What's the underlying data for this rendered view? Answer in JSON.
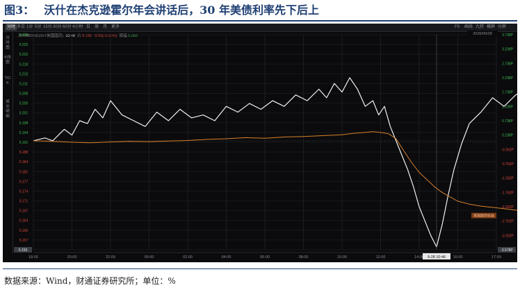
{
  "figure": {
    "number": "图3：",
    "title": "沃什在杰克逊霍尔年会讲话后，30 年美债利率先下后上",
    "source": "数据来源：Wind，财通证券研究所；单位：%"
  },
  "toolbar": {
    "items": [
      "分时",
      "多日",
      "1分",
      "5分",
      "15分",
      "30分",
      "60分",
      "4小时",
      "日",
      "周",
      "月",
      "更多"
    ],
    "right_items": [
      "F9",
      "画线",
      "九转",
      "横屏",
      "分屏"
    ],
    "date": "2026/09/28"
  },
  "info_bar": {
    "symbol": "30YRBOND(30Y",
    "market": "美国国债)",
    "time": "10:46",
    "price_label": "价",
    "price": "5.156",
    "change": "-5.53(-0.60%)",
    "volume_label": "振幅",
    "volume": "0.000"
  },
  "sidebar": [
    "分时图",
    "K线图",
    "TICK",
    "成交明细"
  ],
  "colors": {
    "price_line": "#f2f2f2",
    "pct_line": "#d9822b",
    "axis_left": "#e2483f",
    "axis_right": "#e2483f",
    "axis_up": "#3fbf55"
  },
  "chart_data": {
    "type": "line",
    "x_ticks": [
      "18:00",
      "20:00",
      "22:00",
      "00:00",
      "02:00",
      "04:00",
      "06:00",
      "08:00",
      "10:00",
      "12:00",
      "14:00",
      "16:00",
      "17:59"
    ],
    "y_left_ticks": [
      "5.228",
      "5.225",
      "5.222",
      "5.218",
      "5.215",
      "5.211",
      "5.208",
      "5.205",
      "5.201",
      "5.198",
      "5.194",
      "5.191",
      "5.188",
      "5.184",
      "5.181",
      "5.177",
      "5.174",
      "5.171",
      "5.167",
      "5.164",
      "5.160",
      "5.157",
      "5.153"
    ],
    "y_right_ticks": [
      "3.738P",
      "3.238P",
      "2.738P",
      "2.238P",
      "1.738P",
      "1.238P",
      "0.738P",
      "0.238P",
      "-0.262P",
      "-0.762P",
      "-1.262P",
      "-1.762P",
      "-2.262P",
      "-2.762P",
      "-3.262P",
      "-3.738P"
    ],
    "ylim_left": [
      5.153,
      5.228
    ],
    "ylim_right": [
      -3.738,
      3.738
    ],
    "crosshair_time": "9-28 10:46",
    "crosshair_price": "5.155",
    "crosshair_value": "-3.578P",
    "end_label": "美国国债收益",
    "series": [
      {
        "kind": "price",
        "axis": "left",
        "x": [
          0,
          0.3,
          0.5,
          0.8,
          1.0,
          1.2,
          1.4,
          1.6,
          1.8,
          2.0,
          2.3,
          2.6,
          2.9,
          3.2,
          3.5,
          3.8,
          4.1,
          4.4,
          4.7,
          5.0,
          5.3,
          5.6,
          5.9,
          6.2,
          6.5,
          6.8,
          7.1,
          7.4,
          7.6,
          7.8,
          8.0,
          8.2,
          8.4,
          8.6,
          8.8,
          8.95,
          9.1,
          9.25,
          9.4,
          9.55,
          9.7,
          9.85,
          10.0,
          10.15,
          10.3,
          10.45,
          10.6,
          10.75,
          10.9,
          11.1,
          11.3,
          11.6,
          11.9,
          12.2,
          12.5,
          12.8,
          13.1,
          13.4,
          13.7,
          14.0,
          14.3,
          14.6,
          14.9,
          15.2,
          15.5,
          15.8,
          16.0,
          16.2,
          16.4,
          16.6,
          16.8,
          17.0
        ],
        "y": [
          5.191,
          5.192,
          5.191,
          5.195,
          5.193,
          5.198,
          5.197,
          5.202,
          5.199,
          5.205,
          5.2,
          5.198,
          5.196,
          5.201,
          5.198,
          5.202,
          5.199,
          5.2,
          5.198,
          5.203,
          5.201,
          5.204,
          5.202,
          5.205,
          5.203,
          5.207,
          5.205,
          5.209,
          5.206,
          5.211,
          5.208,
          5.213,
          5.209,
          5.203,
          5.205,
          5.2,
          5.203,
          5.196,
          5.191,
          5.186,
          5.181,
          5.175,
          5.168,
          5.163,
          5.158,
          5.154,
          5.162,
          5.172,
          5.181,
          5.19,
          5.197,
          5.201,
          5.206,
          5.203,
          5.207,
          5.209,
          5.206,
          5.209,
          5.207,
          5.205,
          5.208,
          5.212,
          5.21,
          5.214,
          5.216,
          5.212,
          5.215,
          5.213,
          5.208,
          5.21,
          5.206,
          5.206
        ]
      },
      {
        "kind": "change",
        "axis": "right",
        "x": [
          0,
          0.5,
          1.0,
          1.5,
          2.0,
          2.5,
          3.0,
          3.5,
          4.0,
          4.5,
          5.0,
          5.5,
          6.0,
          6.5,
          7.0,
          7.5,
          8.0,
          8.3,
          8.6,
          8.8,
          9.0,
          9.2,
          9.4,
          9.6,
          9.8,
          10.0,
          10.2,
          10.4,
          10.6,
          10.8,
          11.0,
          11.3,
          11.6,
          12.0,
          12.5,
          13.0,
          13.5,
          14.0,
          14.5,
          15.0,
          15.5,
          15.8,
          16.0,
          16.2,
          16.4,
          16.6,
          16.8,
          17.0
        ],
        "y": [
          0.05,
          0.03,
          0.0,
          -0.02,
          0.01,
          0.03,
          0.02,
          0.04,
          0.06,
          0.1,
          0.12,
          0.16,
          0.14,
          0.18,
          0.2,
          0.23,
          0.26,
          0.31,
          0.34,
          0.37,
          0.34,
          0.3,
          0.12,
          -0.3,
          -0.7,
          -1.05,
          -1.3,
          -1.55,
          -1.75,
          -1.9,
          -2.05,
          -2.15,
          -2.22,
          -2.28,
          -2.36,
          -2.42,
          -2.49,
          -2.56,
          -2.62,
          -2.68,
          -2.75,
          -2.8,
          -2.87,
          -2.9,
          -2.85,
          -2.7,
          -2.55,
          -2.5
        ]
      }
    ]
  }
}
